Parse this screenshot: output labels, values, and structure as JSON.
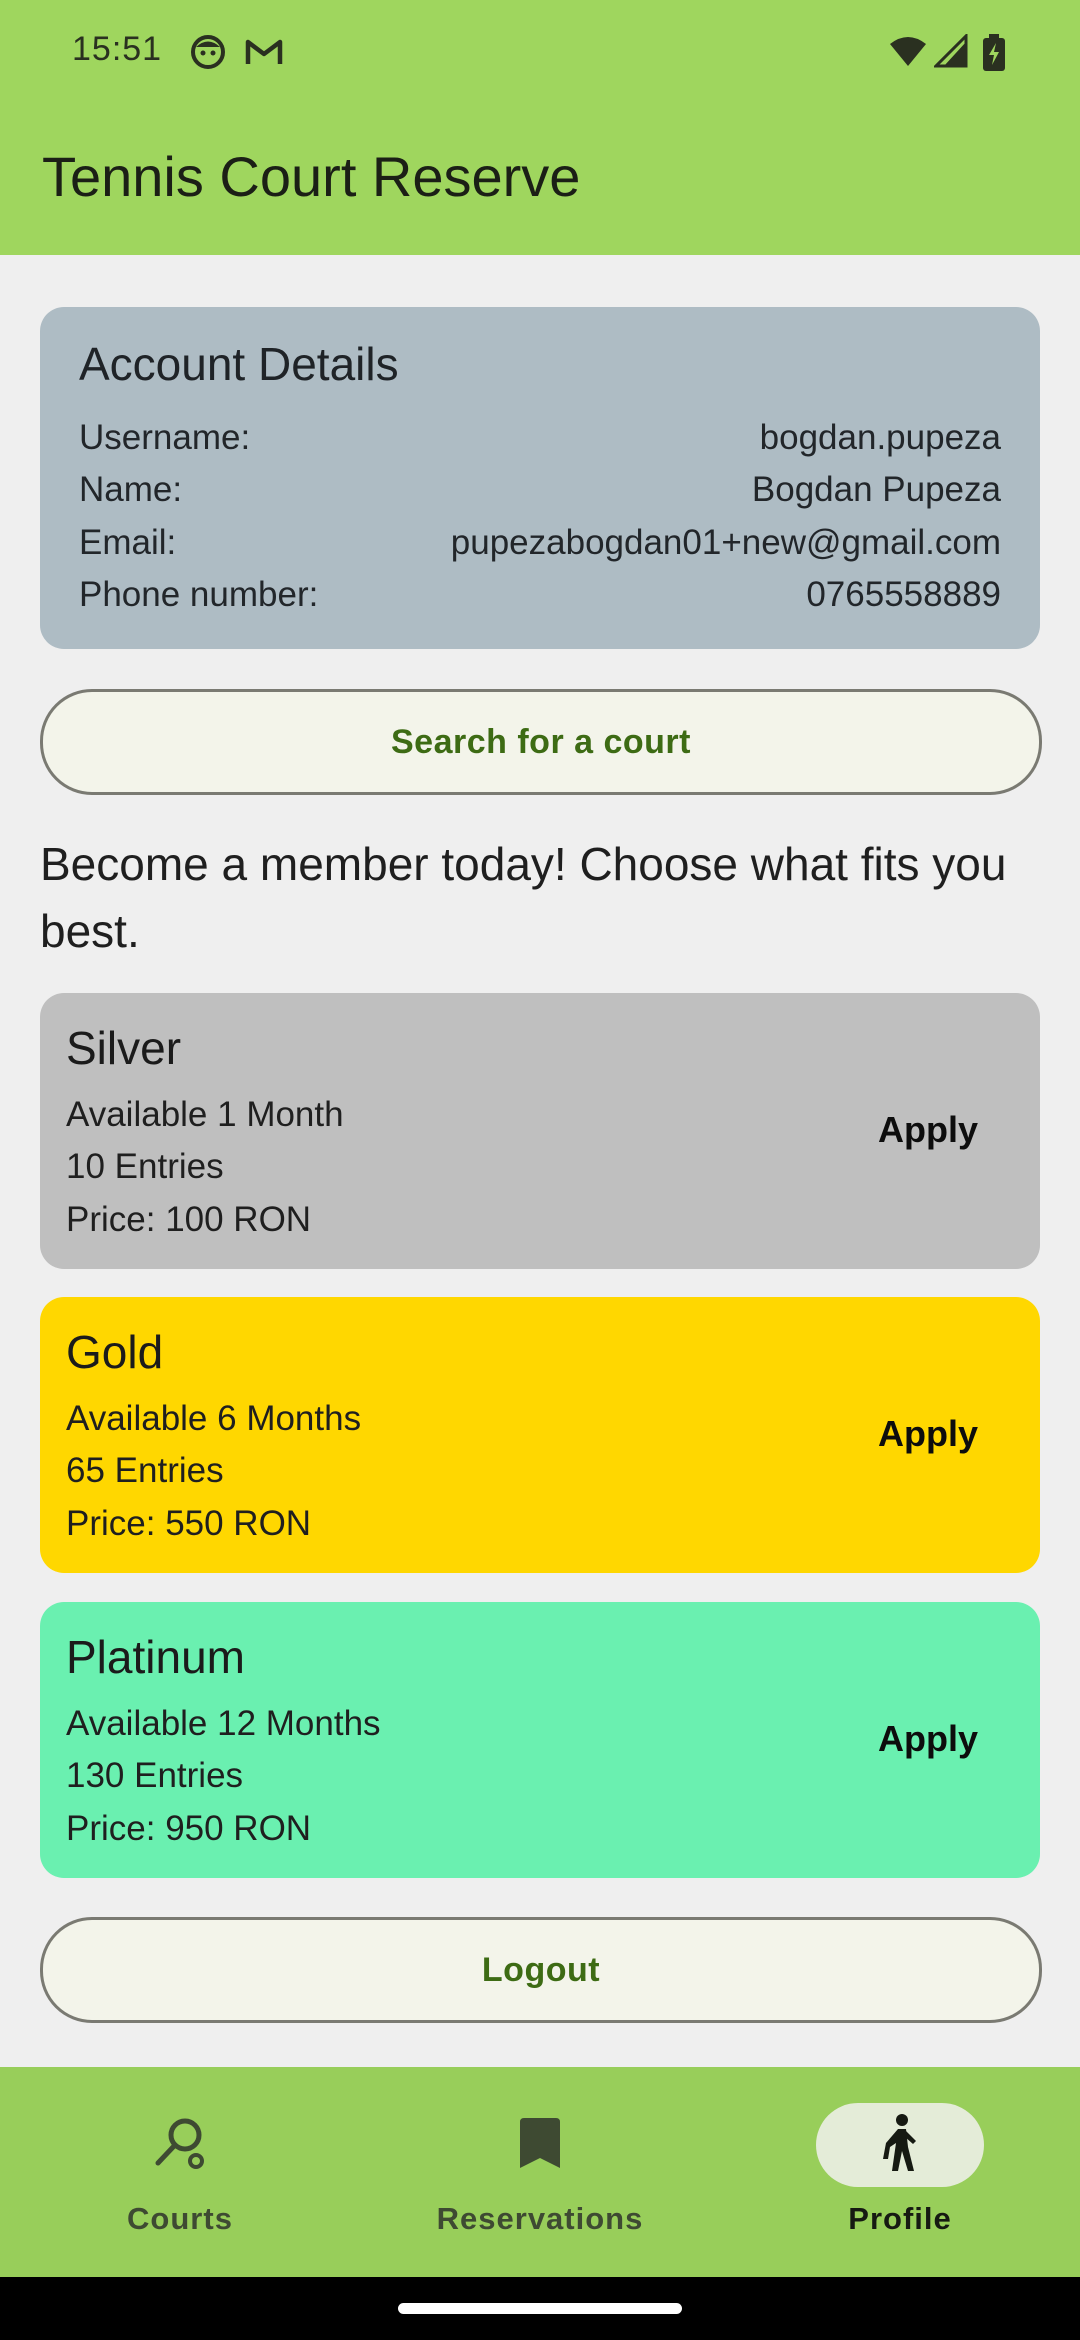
{
  "status_bar": {
    "time": "15:51",
    "icons": [
      "face-notification-icon",
      "gmail-icon",
      "wifi-icon",
      "signal-icon",
      "battery-charging-icon"
    ]
  },
  "app_bar": {
    "title": "Tennis Court Reserve"
  },
  "account": {
    "title": "Account Details",
    "rows": [
      {
        "label": "Username:",
        "value": "bogdan.pupeza"
      },
      {
        "label": "Name:",
        "value": "Bogdan Pupeza"
      },
      {
        "label": "Email:",
        "value": "pupezabogdan01+new@gmail.com"
      },
      {
        "label": "Phone number:",
        "value": "0765558889"
      }
    ]
  },
  "search_button": {
    "label": "Search for a court"
  },
  "promo": {
    "text": "Become a member today! Choose what fits you best."
  },
  "plans": [
    {
      "name": "Silver",
      "duration": "Available 1 Month",
      "entries": "10 Entries",
      "price": "Price: 100 RON",
      "action": "Apply",
      "color": "#bfbfbf"
    },
    {
      "name": "Gold",
      "duration": "Available 6 Months",
      "entries": "65 Entries",
      "price": "Price: 550 RON",
      "action": "Apply",
      "color": "#ffd700"
    },
    {
      "name": "Platinum",
      "duration": "Available 12 Months",
      "entries": "130 Entries",
      "price": "Price: 950 RON",
      "action": "Apply",
      "color": "#6af0b0"
    }
  ],
  "logout_button": {
    "label": "Logout"
  },
  "bottom_nav": {
    "items": [
      {
        "label": "Courts",
        "icon": "racket-icon",
        "active": false
      },
      {
        "label": "Reservations",
        "icon": "bookmark-icon",
        "active": false
      },
      {
        "label": "Profile",
        "icon": "walking-person-icon",
        "active": true
      }
    ]
  },
  "colors": {
    "app_bar": "#9fd65e",
    "bottom_nav": "#98ce5a",
    "account_card": "#aebcc4",
    "button_text": "#3d6b14"
  }
}
